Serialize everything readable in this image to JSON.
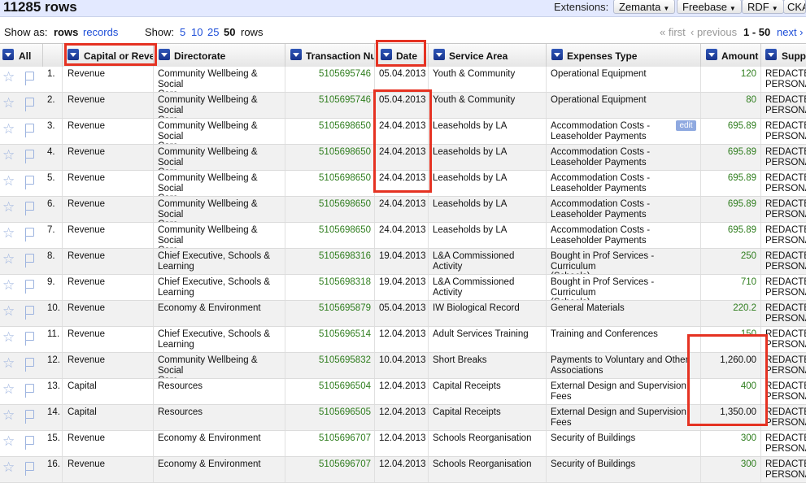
{
  "header": {
    "row_count": "11285 rows",
    "extensions_label": "Extensions:",
    "extensions": [
      "Zemanta",
      "Freebase",
      "RDF",
      "CKA"
    ]
  },
  "viewbar": {
    "show_as_label": "Show as:",
    "rows_label": "rows",
    "records_label": "records",
    "show_label": "Show:",
    "page_sizes": [
      "5",
      "10",
      "25",
      "50"
    ],
    "page_size_selected": "50",
    "rows_word": "rows",
    "first_label": "« first",
    "previous_label": "‹ previous",
    "range_label": "1 - 50",
    "next_label": "next ›"
  },
  "columns": {
    "all": "All",
    "capital": "Capital or Rever",
    "directorate": "Directorate",
    "transaction": "Transaction Nur",
    "date": "Date",
    "service_area": "Service Area",
    "expenses_type": "Expenses Type",
    "amount": "Amount",
    "supplier": "Supp"
  },
  "edit_label": "edit",
  "rows": [
    {
      "n": "1.",
      "cap": "Revenue",
      "dir1": "Community Wellbeing & Social",
      "dir2": "Care",
      "tx": "5105695746",
      "date": "05.04.2013",
      "svc1": "Youth & Community",
      "svc2": "",
      "exp1": "Operational Equipment",
      "exp2": "",
      "amt": "120",
      "amt_num": true,
      "sup1": "REDACTE",
      "sup2": "PERSONA"
    },
    {
      "n": "2.",
      "cap": "Revenue",
      "dir1": "Community Wellbeing & Social",
      "dir2": "Care",
      "tx": "5105695746",
      "date": "05.04.2013",
      "svc1": "Youth & Community",
      "svc2": "",
      "exp1": "Operational Equipment",
      "exp2": "",
      "amt": "80",
      "amt_num": true,
      "sup1": "REDACTE",
      "sup2": "PERSONA"
    },
    {
      "n": "3.",
      "cap": "Revenue",
      "dir1": "Community Wellbeing & Social",
      "dir2": "Care",
      "tx": "5105698650",
      "date": "24.04.2013",
      "svc1": "Leaseholds by LA",
      "svc2": "",
      "exp1": "Accommodation Costs -",
      "exp2": "Leaseholder Payments",
      "amt": "695.89",
      "amt_num": true,
      "sup1": "REDACTE",
      "sup2": "PERSONA"
    },
    {
      "n": "4.",
      "cap": "Revenue",
      "dir1": "Community Wellbeing & Social",
      "dir2": "Care",
      "tx": "5105698650",
      "date": "24.04.2013",
      "svc1": "Leaseholds by LA",
      "svc2": "",
      "exp1": "Accommodation Costs -",
      "exp2": "Leaseholder Payments",
      "amt": "695.89",
      "amt_num": true,
      "sup1": "REDACTE",
      "sup2": "PERSONA"
    },
    {
      "n": "5.",
      "cap": "Revenue",
      "dir1": "Community Wellbeing & Social",
      "dir2": "Care",
      "tx": "5105698650",
      "date": "24.04.2013",
      "svc1": "Leaseholds by LA",
      "svc2": "",
      "exp1": "Accommodation Costs -",
      "exp2": "Leaseholder Payments",
      "amt": "695.89",
      "amt_num": true,
      "sup1": "REDACTE",
      "sup2": "PERSONA"
    },
    {
      "n": "6.",
      "cap": "Revenue",
      "dir1": "Community Wellbeing & Social",
      "dir2": "Care",
      "tx": "5105698650",
      "date": "24.04.2013",
      "svc1": "Leaseholds by LA",
      "svc2": "",
      "exp1": "Accommodation Costs -",
      "exp2": "Leaseholder Payments",
      "amt": "695.89",
      "amt_num": true,
      "sup1": "REDACTE",
      "sup2": "PERSONA"
    },
    {
      "n": "7.",
      "cap": "Revenue",
      "dir1": "Community Wellbeing & Social",
      "dir2": "Care",
      "tx": "5105698650",
      "date": "24.04.2013",
      "svc1": "Leaseholds by LA",
      "svc2": "",
      "exp1": "Accommodation Costs -",
      "exp2": "Leaseholder Payments",
      "amt": "695.89",
      "amt_num": true,
      "sup1": "REDACTE",
      "sup2": "PERSONA"
    },
    {
      "n": "8.",
      "cap": "Revenue",
      "dir1": "Chief Executive, Schools &",
      "dir2": "Learning",
      "tx": "5105698316",
      "date": "19.04.2013",
      "svc1": "L&A Commissioned Activity",
      "svc2": "",
      "exp1": "Bought in Prof Services - Curriculum",
      "exp2": "(Schools)",
      "amt": "250",
      "amt_num": true,
      "sup1": "REDACTE",
      "sup2": "PERSONA"
    },
    {
      "n": "9.",
      "cap": "Revenue",
      "dir1": "Chief Executive, Schools &",
      "dir2": "Learning",
      "tx": "5105698318",
      "date": "19.04.2013",
      "svc1": "L&A Commissioned Activity",
      "svc2": "",
      "exp1": "Bought in Prof Services - Curriculum",
      "exp2": "(Schools)",
      "amt": "710",
      "amt_num": true,
      "sup1": "REDACTE",
      "sup2": "PERSONA"
    },
    {
      "n": "10.",
      "cap": "Revenue",
      "dir1": "Economy & Environment",
      "dir2": "",
      "tx": "5105695879",
      "date": "05.04.2013",
      "svc1": "IW Biological Record",
      "svc2": "",
      "exp1": "General Materials",
      "exp2": "",
      "amt": "220.2",
      "amt_num": true,
      "sup1": "REDACTE",
      "sup2": "PERSONA"
    },
    {
      "n": "11.",
      "cap": "Revenue",
      "dir1": "Chief Executive, Schools &",
      "dir2": "Learning",
      "tx": "5105696514",
      "date": "12.04.2013",
      "svc1": "Adult Services Training",
      "svc2": "",
      "exp1": "Training and Conferences",
      "exp2": "",
      "amt": "150",
      "amt_num": true,
      "sup1": "REDACTE",
      "sup2": "PERSONA"
    },
    {
      "n": "12.",
      "cap": "Revenue",
      "dir1": "Community Wellbeing & Social",
      "dir2": "Care",
      "tx": "5105695832",
      "date": "10.04.2013",
      "svc1": "Short Breaks",
      "svc2": "",
      "exp1": "Payments to Voluntary and Other",
      "exp2": "Associations",
      "amt": "1,260.00",
      "amt_num": false,
      "sup1": "REDACTE",
      "sup2": "PERSONA"
    },
    {
      "n": "13.",
      "cap": "Capital",
      "dir1": "Resources",
      "dir2": "",
      "tx": "5105696504",
      "date": "12.04.2013",
      "svc1": "Capital Receipts",
      "svc2": "",
      "exp1": "External Design and Supervision",
      "exp2": "Fees",
      "amt": "400",
      "amt_num": true,
      "sup1": "REDACTE",
      "sup2": "PERSONA"
    },
    {
      "n": "14.",
      "cap": "Capital",
      "dir1": "Resources",
      "dir2": "",
      "tx": "5105696505",
      "date": "12.04.2013",
      "svc1": "Capital Receipts",
      "svc2": "",
      "exp1": "External Design and Supervision",
      "exp2": "Fees",
      "amt": "1,350.00",
      "amt_num": false,
      "sup1": "REDACTE",
      "sup2": "PERSONA"
    },
    {
      "n": "15.",
      "cap": "Revenue",
      "dir1": "Economy & Environment",
      "dir2": "",
      "tx": "5105696707",
      "date": "12.04.2013",
      "svc1": "Schools Reorganisation",
      "svc2": "",
      "exp1": "Security of Buildings",
      "exp2": "",
      "amt": "300",
      "amt_num": true,
      "sup1": "REDACTE",
      "sup2": "PERSONA"
    },
    {
      "n": "16.",
      "cap": "Revenue",
      "dir1": "Economy & Environment",
      "dir2": "",
      "tx": "5105696707",
      "date": "12.04.2013",
      "svc1": "Schools Reorganisation",
      "svc2": "",
      "exp1": "Security of Buildings",
      "exp2": "",
      "amt": "300",
      "amt_num": true,
      "sup1": "REDACTE",
      "sup2": "PERSONA"
    }
  ]
}
